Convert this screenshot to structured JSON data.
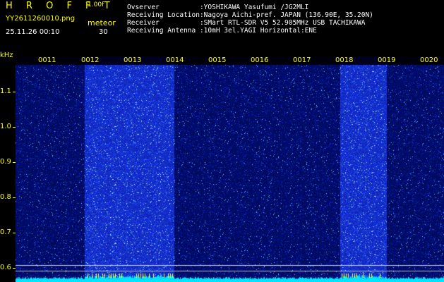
{
  "header": {
    "app_title": "H R O F F T",
    "version": "1.00f",
    "filename": "YY2611260010.png",
    "timestamp": "25.11.26 00:10",
    "meteor_label": "meteor",
    "meteor_count": "30"
  },
  "info": [
    {
      "key": "Ovserver          ",
      "value": ":YOSHIKAWA Yasufumi /JG2MLI"
    },
    {
      "key": "Receiving Location",
      "value": ":Nagoya Aichi-pref. JAPAN (136.90E, 35.20N)"
    },
    {
      "key": "Receiver          ",
      "value": ":SMart RTL-SDR V5 52.905MHz USB TACHIKAWA"
    },
    {
      "key": "Receiving Antenna ",
      "value": ":10mH 3el.YAGI Horizontal:ENE"
    }
  ],
  "spectrogram": {
    "unit": "kHz",
    "y_ticks": [
      "1.1",
      "1.0",
      "0.9",
      "0.8",
      "0.7",
      "0.6"
    ],
    "minute_labels": [
      "0011",
      "0012",
      "0013",
      "0014",
      "0015",
      "0016",
      "0017",
      "0018",
      "0019",
      "0020"
    ],
    "bright_segments": [
      {
        "from_minute": 2,
        "to_minute": 4
      },
      {
        "from_minute": 8,
        "to_minute": 9
      }
    ],
    "colors": {
      "label": "#ffff00",
      "noise_dark": "#050580",
      "noise_bright": "#1a32ff",
      "speckle": "#9fdcff",
      "baseline": "#00e5ff"
    }
  }
}
